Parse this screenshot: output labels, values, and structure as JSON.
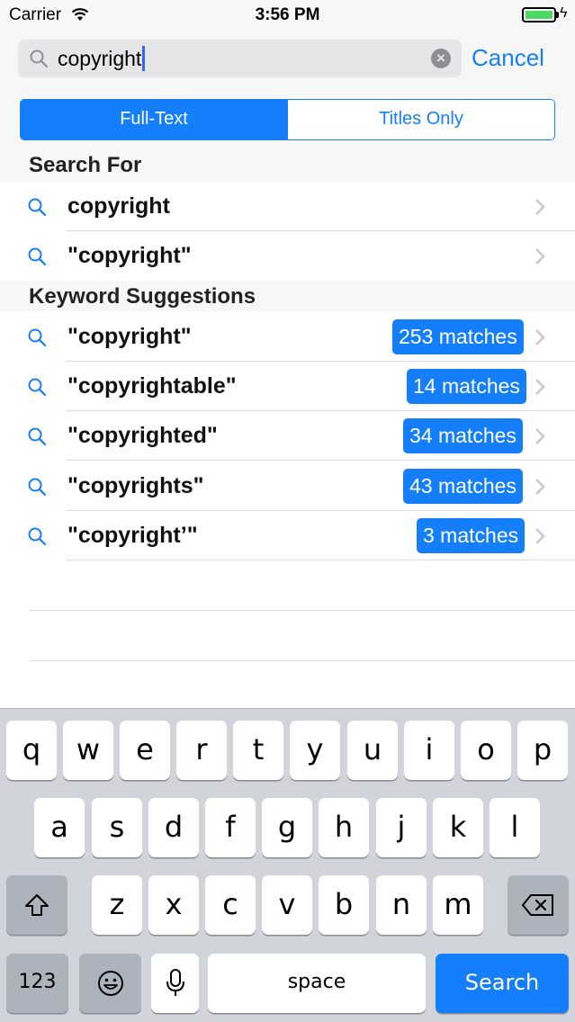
{
  "status_bar": {
    "carrier": "Carrier",
    "time": "3:56 PM"
  },
  "search": {
    "query": "copyright",
    "cancel_label": "Cancel"
  },
  "segments": {
    "full_text": "Full-Text",
    "titles_only": "Titles Only"
  },
  "sections": {
    "search_for": {
      "title": "Search For",
      "rows": [
        {
          "label": "copyright"
        },
        {
          "label": "\"copyright\""
        }
      ]
    },
    "keyword_suggestions": {
      "title": "Keyword Suggestions",
      "rows": [
        {
          "label": "\"copyright\"",
          "matches": "253 matches"
        },
        {
          "label": "\"copyrightable\"",
          "matches": "14 matches"
        },
        {
          "label": "\"copyrighted\"",
          "matches": "34 matches"
        },
        {
          "label": "\"copyrights\"",
          "matches": "43 matches"
        },
        {
          "label": "\"copyright’\"",
          "matches": "3 matches"
        }
      ]
    }
  },
  "keyboard": {
    "row1": [
      "q",
      "w",
      "e",
      "r",
      "t",
      "y",
      "u",
      "i",
      "o",
      "p"
    ],
    "row2": [
      "a",
      "s",
      "d",
      "f",
      "g",
      "h",
      "j",
      "k",
      "l"
    ],
    "row3": [
      "z",
      "x",
      "c",
      "v",
      "b",
      "n",
      "m"
    ],
    "numbers_label": "123",
    "space_label": "space",
    "search_label": "Search"
  },
  "colors": {
    "accent": "#157efb",
    "battery": "#4cd964",
    "keyboard_bg": "#d1d4da"
  },
  "icons": [
    "wifi-icon",
    "battery-icon",
    "search-icon",
    "clear-icon",
    "chevron-right-icon",
    "shift-icon",
    "backspace-icon",
    "emoji-icon",
    "microphone-icon"
  ]
}
